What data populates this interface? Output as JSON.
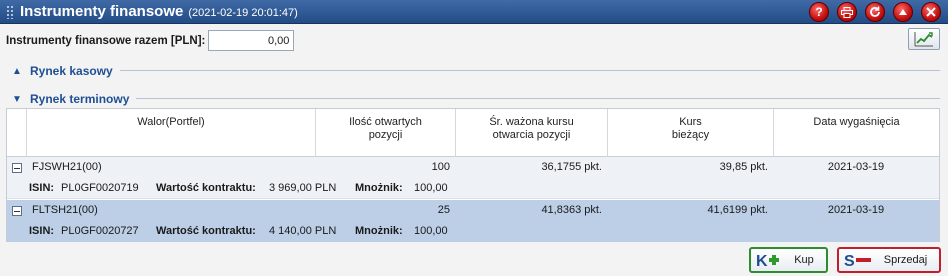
{
  "window": {
    "title": "Instrumenty finansowe",
    "timestamp": "(2021-02-19 20:01:47)",
    "buttons": [
      "help-icon",
      "print-icon",
      "refresh-icon",
      "collapse-icon",
      "close-icon"
    ]
  },
  "summary": {
    "label": "Instrumenty finansowe razem [PLN]:",
    "value": "0,00"
  },
  "sections": {
    "cash": "Rynek kasowy",
    "futures": "Rynek terminowy"
  },
  "table": {
    "columns": [
      "Walor(Portfel)",
      "Ilość otwartych pozycji",
      "Śr. ważona kursu otwarcia pozycji",
      "Kurs bieżący",
      "Data wygaśnięcia"
    ],
    "detail_labels": {
      "isin": "ISIN:",
      "value": "Wartość kontraktu:",
      "multiplier": "Mnożnik:"
    },
    "rows": [
      {
        "name": "FJSWH21(00)",
        "qty": "100",
        "avg_open": "36,1755 pkt.",
        "current": "39,85 pkt.",
        "expiry": "2021-03-19",
        "isin": "PL0GF0020719",
        "contract_value": "3 969,00 PLN",
        "multiplier": "100,00"
      },
      {
        "name": "FLTSH21(00)",
        "qty": "25",
        "avg_open": "41,8363 pkt.",
        "current": "41,6199 pkt.",
        "expiry": "2021-03-19",
        "isin": "PL0GF0020727",
        "contract_value": "4 140,00 PLN",
        "multiplier": "100,00"
      }
    ]
  },
  "actions": {
    "buy": "Kup",
    "sell": "Sprzedaj"
  },
  "colors": {
    "titlebar": "#2c558f",
    "section": "#1e4f93",
    "selected_row": "#bccfe7",
    "buy": "#2e8b2e",
    "sell": "#c21d2a"
  }
}
